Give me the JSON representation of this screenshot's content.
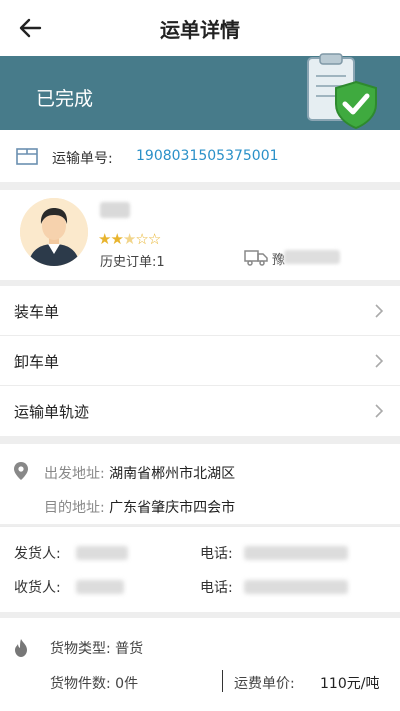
{
  "header": {
    "title": "运单详情"
  },
  "status": {
    "text": "已完成"
  },
  "waybill": {
    "label": "运输单号:",
    "number": "1908031505375001"
  },
  "driver": {
    "rating": 2.5,
    "rating_max": 5,
    "history": "历史订单:1",
    "plate_prefix": "豫"
  },
  "menu": {
    "items": [
      {
        "label": "装车单"
      },
      {
        "label": "卸车单"
      },
      {
        "label": "运输单轨迹"
      }
    ]
  },
  "address": {
    "from_key": "出发地址:",
    "from_val": "湖南省郴州市北湖区",
    "to_key": "目的地址:",
    "to_val": "广东省肇庆市四会市"
  },
  "contacts": {
    "shipper_label": "发货人:",
    "shipper_phone_label": "电话:",
    "receiver_label": "收货人:",
    "receiver_phone_label": "电话:"
  },
  "goods": {
    "type": "货物类型:  普货",
    "count": "货物件数:  0件",
    "price_label": "运费单价:",
    "price_value": "110元/吨"
  },
  "colors": {
    "banner": "#477b8a",
    "link": "#2a90c8",
    "star": "#e8b42e"
  }
}
